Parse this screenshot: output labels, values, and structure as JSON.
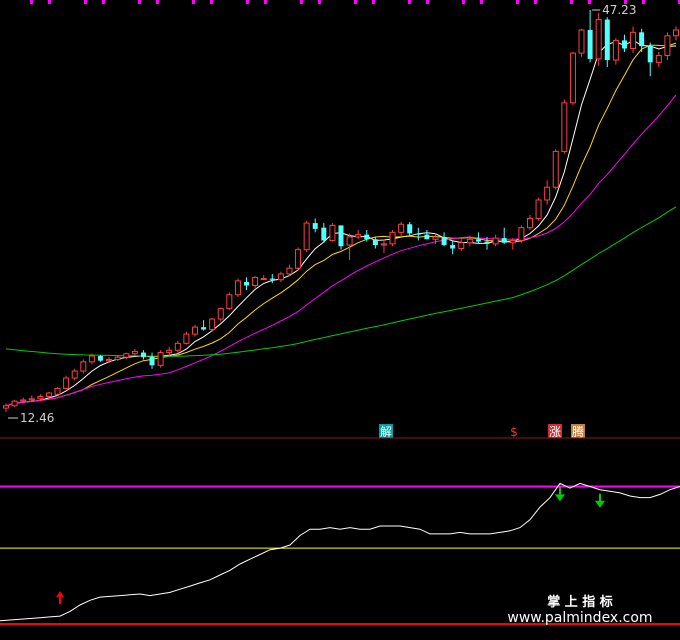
{
  "chart_data": [
    {
      "type": "candlestick",
      "price_high_label": "47.23",
      "price_low_label": "12.46",
      "ylim": [
        12.46,
        47.23
      ],
      "candles": [
        [
          12.8,
          13.2,
          12.46,
          13.0
        ],
        [
          13.0,
          13.5,
          12.9,
          13.4
        ],
        [
          13.4,
          13.7,
          13.2,
          13.5
        ],
        [
          13.5,
          13.9,
          13.3,
          13.6
        ],
        [
          13.6,
          14.0,
          13.4,
          13.8
        ],
        [
          13.8,
          14.2,
          13.6,
          14.1
        ],
        [
          14.0,
          14.6,
          13.9,
          14.5
        ],
        [
          14.5,
          15.6,
          14.4,
          15.4
        ],
        [
          15.4,
          16.2,
          15.2,
          16.0
        ],
        [
          16.0,
          17.0,
          15.8,
          16.8
        ],
        [
          16.8,
          17.5,
          16.6,
          17.3
        ],
        [
          17.3,
          17.4,
          16.8,
          16.9
        ],
        [
          16.9,
          17.2,
          16.7,
          17.0
        ],
        [
          17.0,
          17.4,
          16.9,
          17.2
        ],
        [
          17.2,
          17.6,
          17.0,
          17.5
        ],
        [
          17.5,
          17.9,
          17.3,
          17.7
        ],
        [
          17.6,
          17.8,
          17.0,
          17.2
        ],
        [
          17.2,
          17.6,
          16.2,
          16.5
        ],
        [
          16.5,
          17.8,
          16.3,
          17.6
        ],
        [
          17.6,
          18.1,
          17.2,
          17.8
        ],
        [
          17.8,
          18.6,
          17.6,
          18.4
        ],
        [
          18.4,
          19.4,
          18.3,
          19.2
        ],
        [
          19.2,
          20.0,
          19.0,
          19.8
        ],
        [
          19.8,
          20.4,
          19.5,
          19.6
        ],
        [
          19.6,
          20.6,
          19.4,
          20.5
        ],
        [
          20.5,
          21.5,
          20.3,
          21.4
        ],
        [
          21.4,
          22.8,
          21.3,
          22.6
        ],
        [
          22.6,
          24.0,
          22.4,
          23.8
        ],
        [
          23.7,
          24.1,
          23.0,
          23.4
        ],
        [
          23.4,
          24.2,
          23.2,
          24.1
        ],
        [
          24.0,
          24.3,
          23.9,
          24.0
        ],
        [
          24.0,
          24.4,
          23.6,
          23.9
        ],
        [
          23.9,
          24.6,
          23.7,
          24.4
        ],
        [
          24.4,
          25.2,
          24.2,
          24.9
        ],
        [
          24.9,
          26.7,
          24.7,
          26.5
        ],
        [
          26.5,
          29.0,
          26.3,
          28.8
        ],
        [
          28.8,
          29.2,
          28.0,
          28.3
        ],
        [
          28.4,
          28.8,
          27.1,
          27.3
        ],
        [
          27.3,
          28.8,
          27.2,
          28.6
        ],
        [
          28.6,
          28.6,
          26.5,
          26.8
        ],
        [
          26.9,
          27.9,
          25.6,
          27.6
        ],
        [
          27.6,
          28.2,
          27.4,
          27.8
        ],
        [
          27.8,
          28.2,
          27.2,
          27.4
        ],
        [
          27.4,
          27.6,
          26.6,
          26.9
        ],
        [
          26.9,
          27.4,
          26.2,
          27.0
        ],
        [
          27.0,
          28.2,
          26.8,
          28.0
        ],
        [
          28.0,
          28.9,
          27.6,
          28.7
        ],
        [
          28.7,
          28.9,
          27.7,
          27.9
        ],
        [
          27.9,
          28.4,
          27.3,
          27.8
        ],
        [
          27.8,
          28.2,
          27.4,
          27.4
        ],
        [
          27.4,
          27.9,
          27.0,
          27.6
        ],
        [
          27.6,
          28.0,
          26.8,
          26.9
        ],
        [
          26.9,
          27.3,
          26.1,
          26.6
        ],
        [
          26.6,
          27.4,
          26.4,
          27.1
        ],
        [
          27.1,
          27.7,
          26.8,
          27.4
        ],
        [
          27.4,
          28.0,
          27.0,
          27.2
        ],
        [
          27.2,
          27.6,
          26.5,
          27.0
        ],
        [
          27.0,
          27.8,
          26.8,
          27.5
        ],
        [
          27.5,
          28.4,
          27.0,
          27.1
        ],
        [
          27.1,
          27.5,
          26.5,
          27.3
        ],
        [
          27.3,
          28.6,
          27.1,
          28.4
        ],
        [
          28.4,
          29.5,
          28.2,
          29.2
        ],
        [
          29.2,
          31.0,
          29.0,
          30.8
        ],
        [
          30.8,
          32.5,
          30.4,
          31.9
        ],
        [
          31.9,
          35.2,
          31.7,
          35.0
        ],
        [
          35.0,
          39.5,
          34.8,
          39.2
        ],
        [
          39.2,
          43.6,
          39.0,
          43.5
        ],
        [
          43.5,
          45.6,
          43.2,
          45.5
        ],
        [
          45.5,
          47.23,
          42.7,
          43.0
        ],
        [
          43.0,
          47.0,
          42.4,
          46.4
        ],
        [
          46.4,
          46.6,
          42.3,
          42.9
        ],
        [
          42.9,
          44.8,
          42.5,
          44.6
        ],
        [
          44.6,
          45.1,
          43.6,
          43.9
        ],
        [
          43.9,
          45.8,
          43.5,
          45.3
        ],
        [
          45.3,
          45.6,
          43.6,
          44.1
        ],
        [
          44.1,
          44.4,
          41.5,
          42.7
        ],
        [
          42.7,
          43.6,
          42.3,
          43.3
        ],
        [
          43.3,
          45.3,
          42.9,
          45.0
        ],
        [
          45.0,
          45.8,
          44.6,
          45.5
        ]
      ],
      "moving_averages": [
        {
          "color": "#ffffff",
          "window": 5
        },
        {
          "color": "#ffd700",
          "window": 10
        },
        {
          "color": "#ff00ff",
          "window": 20
        },
        {
          "color": "#00cc00",
          "window": 60
        }
      ],
      "ma60_start": 18.0
    },
    {
      "type": "line",
      "ylim": [
        0,
        100
      ],
      "reference_levels": [
        {
          "value": 87,
          "color": "#ff00ff"
        },
        {
          "value": 48,
          "color": "#ffff00"
        },
        {
          "value": 0,
          "color": "#ff0000"
        }
      ],
      "series": [
        {
          "color": "#ffffff",
          "values": [
            2,
            2.5,
            3,
            3.5,
            4,
            4.5,
            5,
            8,
            12,
            15,
            17,
            17.5,
            18,
            18.5,
            19,
            18,
            19,
            20,
            22,
            24,
            26,
            28,
            31,
            34,
            38,
            41,
            44,
            47,
            48,
            50,
            56,
            60,
            60,
            61,
            60,
            61,
            60,
            60,
            62,
            62,
            62,
            61,
            60,
            57,
            57,
            57,
            58,
            57,
            57,
            57,
            58,
            59,
            61,
            66,
            74,
            80,
            89,
            86,
            89,
            87,
            85,
            84,
            83,
            81,
            80,
            80,
            82,
            85,
            87
          ]
        }
      ],
      "markers": [
        {
          "type": "up-arrow",
          "x_index": 6,
          "color": "#ff0000"
        },
        {
          "type": "down-arrow",
          "x_index": 56,
          "color": "#00cc00"
        },
        {
          "type": "down-arrow",
          "x_index": 60,
          "color": "#00cc00"
        }
      ]
    }
  ],
  "signals": [
    {
      "text": "解",
      "bg": "#00a0a0",
      "color": "#ffffff"
    },
    {
      "text": "$",
      "bg": "",
      "color": "#ff3030"
    },
    {
      "text": "涨",
      "bg": "#cc3030",
      "color": "#ffffff"
    },
    {
      "text": "腾",
      "bg": "#c08040",
      "color": "#ffffff"
    }
  ],
  "watermark": {
    "line1": "掌 上 指 标",
    "line2": "www.palmindex.com"
  },
  "colors": {
    "bull": "#ff4040",
    "bear": "#54ffff",
    "grid": "#8b1a1a",
    "tick": "#ff00ff"
  }
}
